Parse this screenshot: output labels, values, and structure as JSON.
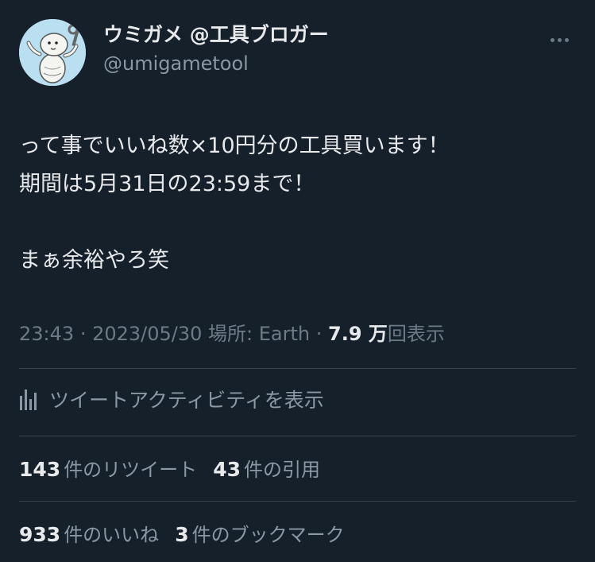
{
  "author": {
    "display_name": "ウミガメ @工具ブロガー",
    "handle": "@umigametool",
    "avatar_icon": "turtle-mascot-icon"
  },
  "tweet": {
    "lines": [
      "って事でいいね数×10円分の工具買います！",
      "期間は5月31日の23:59まで！",
      "",
      "まぁ余裕やろ笑"
    ]
  },
  "meta": {
    "time": "23:43",
    "date": "2023/05/30",
    "location": "場所: Earth",
    "views_count": "7.9 万",
    "views_label": "回表示"
  },
  "activity": {
    "label": "ツイートアクティビティを表示",
    "icon": "bar-chart-icon"
  },
  "stats": {
    "retweets_count": "143",
    "retweets_label": "件のリツイート",
    "quotes_count": "43",
    "quotes_label": "件の引用",
    "likes_count": "933",
    "likes_label": "件のいいね",
    "bookmarks_count": "3",
    "bookmarks_label": "件のブックマーク"
  },
  "colors": {
    "background": "#15202b",
    "text": "#e7e9ea",
    "secondary": "#8b98a5",
    "divider": "#38444d"
  }
}
